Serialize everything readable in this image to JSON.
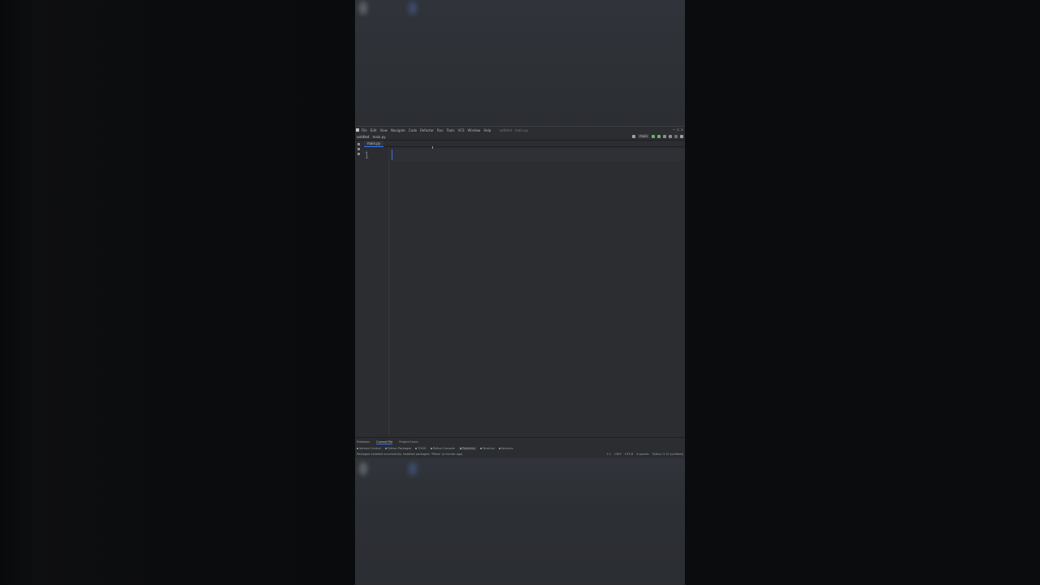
{
  "ide": {
    "logo_label": "PC",
    "menu": [
      "File",
      "Edit",
      "View",
      "Navigate",
      "Code",
      "Refactor",
      "Run",
      "Tools",
      "VCS",
      "Window",
      "Help"
    ],
    "window_title": "untitled - main.py",
    "project_name": "untitled",
    "breadcrumb_file": "main.py",
    "run_config": "main",
    "tab_label": "main.py",
    "line_number": "1",
    "bottom_tabs": [
      "Problems",
      "Current File",
      "Project Errors"
    ],
    "tool_windows": [
      "Version Control",
      "Python Packages",
      "TODO",
      "Python Console",
      "Problems",
      "Terminal",
      "Services"
    ],
    "status_message": "Packages installed successfully: Installed packages: 'Pillow' (a minute ago)",
    "status_right": [
      "1:1",
      "CRLF",
      "UTF-8",
      "4 spaces",
      "Python 3.10 (untitled)"
    ]
  },
  "colors": {
    "accent": "#3574f0",
    "run_green": "#5fb865",
    "background": "#2b2d30"
  }
}
